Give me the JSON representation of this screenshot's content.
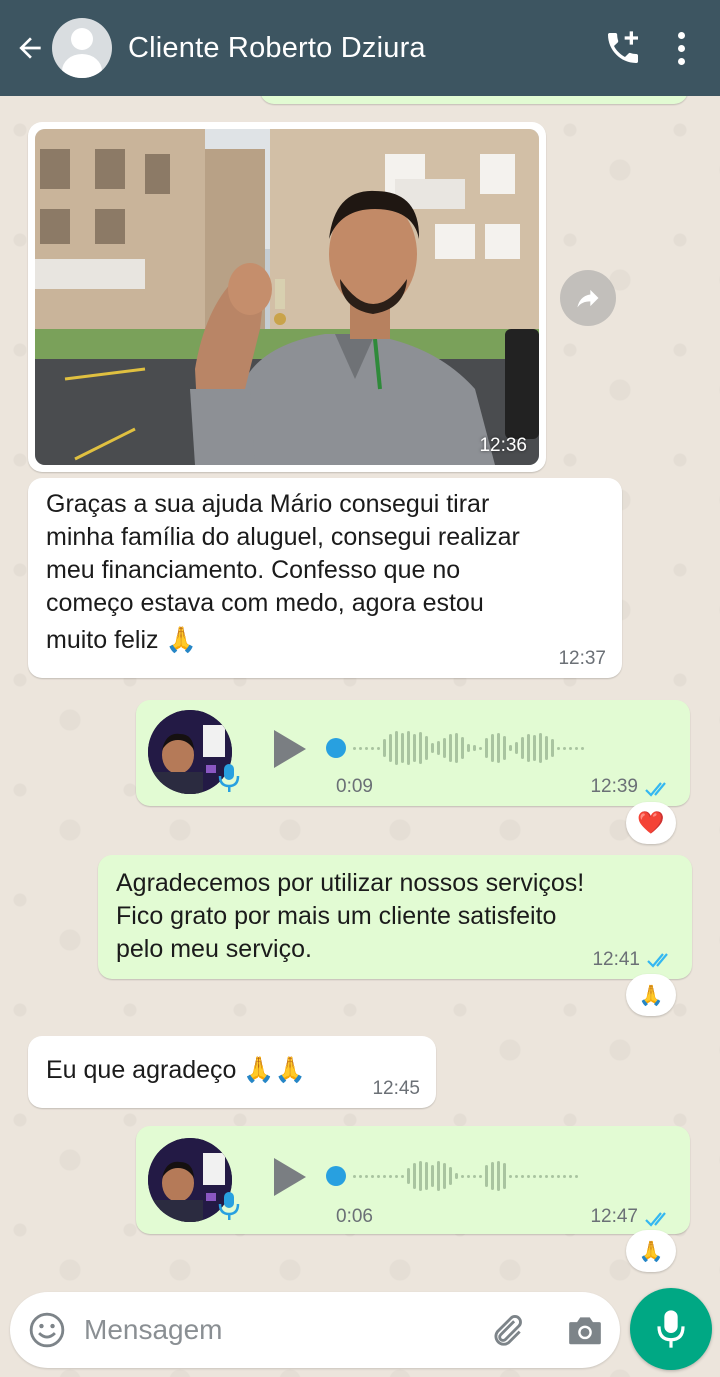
{
  "header": {
    "title": "Cliente Roberto Dziura",
    "back_icon": "arrow-left-icon",
    "call_icon": "add-call-icon",
    "menu_icon": "more-vert-icon"
  },
  "messages": {
    "photo": {
      "time": "12:36"
    },
    "msg1": {
      "lines": [
        "Graças a sua ajuda Mário consegui tirar",
        "minha família do aluguel, consegui realizar",
        "meu financiamento.  Confesso que no",
        "começo estava com medo, agora estou",
        "muito feliz 🙏"
      ],
      "time": "12:37"
    },
    "audio1": {
      "duration": "0:09",
      "time": "12:39",
      "reaction": "❤️"
    },
    "msg2": {
      "lines": [
        "Agradecemos por utilizar nossos serviços!",
        "Fico grato por mais um cliente satisfeito",
        "pelo meu serviço."
      ],
      "time": "12:41",
      "reaction": "🙏"
    },
    "msg3": {
      "text": "Eu que agradeço 🙏🙏",
      "time": "12:45"
    },
    "audio2": {
      "duration": "0:06",
      "time": "12:47",
      "reaction": "🙏"
    }
  },
  "input": {
    "placeholder": "Mensagem",
    "emoji_icon": "emoji-icon",
    "attach_icon": "paperclip-icon",
    "camera_icon": "camera-icon",
    "mic_icon": "mic-icon"
  },
  "colors": {
    "header": "#3d5561",
    "outgoing_bubble": "#e2fbd3",
    "incoming_bubble": "#ffffff",
    "accent": "#00a884",
    "read_ticks": "#34b7f1"
  }
}
